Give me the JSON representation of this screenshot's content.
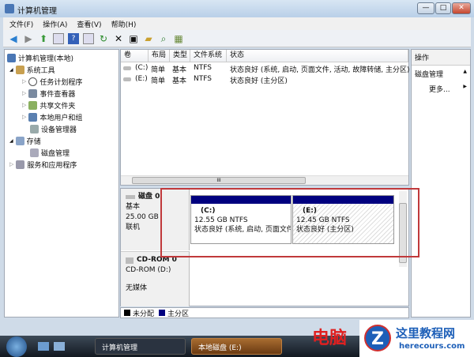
{
  "window": {
    "title": "计算机管理",
    "controls": [
      "—",
      "□",
      "✕"
    ]
  },
  "menu": [
    "文件(F)",
    "操作(A)",
    "查看(V)",
    "帮助(H)"
  ],
  "tree": [
    {
      "label": "计算机管理(本地)",
      "level": 0,
      "expander": ""
    },
    {
      "label": "系统工具",
      "level": 1,
      "expander": "◢"
    },
    {
      "label": "任务计划程序",
      "level": 2,
      "expander": "▷"
    },
    {
      "label": "事件查看器",
      "level": 2,
      "expander": "▷"
    },
    {
      "label": "共享文件夹",
      "level": 2,
      "expander": "▷"
    },
    {
      "label": "本地用户和组",
      "level": 2,
      "expander": "▷"
    },
    {
      "label": "设备管理器",
      "level": 2,
      "expander": ""
    },
    {
      "label": "存储",
      "level": 1,
      "expander": "◢"
    },
    {
      "label": "磁盘管理",
      "level": 2,
      "expander": ""
    },
    {
      "label": "服务和应用程序",
      "level": 1,
      "expander": "▷"
    }
  ],
  "list": {
    "headers": [
      "卷",
      "布局",
      "类型",
      "文件系统",
      "状态"
    ],
    "rows": [
      [
        "(C:)",
        "简单",
        "基本",
        "NTFS",
        "状态良好 (系统, 启动, 页面文件, 活动, 故障转储, 主分区)"
      ],
      [
        "(E:)",
        "简单",
        "基本",
        "NTFS",
        "状态良好 (主分区)"
      ]
    ],
    "scroll_grip": "III"
  },
  "actions": {
    "title": "操作",
    "section": "磁盘管理",
    "more": "更多..."
  },
  "disks": [
    {
      "name": "磁盘 0",
      "type": "基本",
      "size": "25.00 GB",
      "status": "联机",
      "partitions": [
        {
          "label": "(C:)",
          "size": "12.55 GB NTFS",
          "status": "状态良好 (系统, 启动, 页面文件"
        },
        {
          "label": "(E:)",
          "size": "12.45 GB NTFS",
          "status": "状态良好 (主分区)"
        }
      ]
    },
    {
      "name": "CD-ROM 0",
      "type": "CD-ROM (D:)",
      "status": "无媒体"
    }
  ],
  "legend": [
    {
      "label": "未分配",
      "color": "#000000"
    },
    {
      "label": "主分区",
      "color": "#00007f"
    }
  ],
  "taskbar": {
    "items": [
      "计算机管理",
      "本地磁盘 (E:)"
    ]
  },
  "watermark": {
    "red": "电脑",
    "site": "这里教程网",
    "url": "herecours.com"
  }
}
